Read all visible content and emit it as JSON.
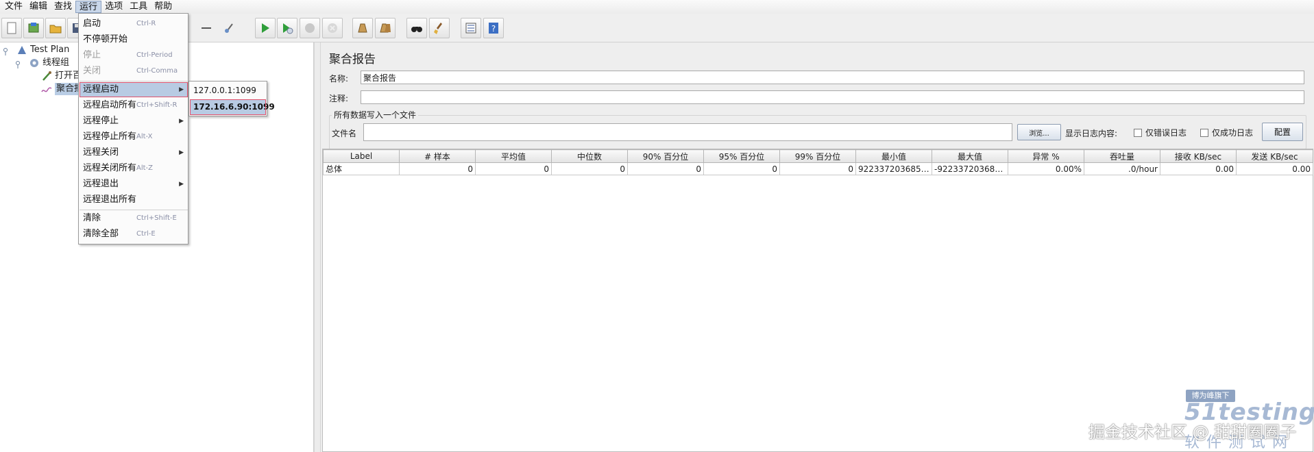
{
  "menubar": [
    "文件",
    "编辑",
    "查找",
    "运行",
    "选项",
    "工具",
    "帮助"
  ],
  "tree": {
    "root": "Test Plan",
    "thread_group": "线程组",
    "child1": "打开百",
    "child2": "聚合报"
  },
  "run_menu": {
    "items": [
      {
        "label": "启动",
        "accel": "Ctrl-R",
        "disabled": false
      },
      {
        "label": "不停顿开始",
        "accel": "",
        "disabled": false
      },
      {
        "label": "停止",
        "accel": "Ctrl-Period",
        "disabled": true
      },
      {
        "label": "关闭",
        "accel": "Ctrl-Comma",
        "disabled": true
      },
      {
        "label": "远程启动",
        "accel": "",
        "submenu": true,
        "highlighted": true
      },
      {
        "label": "远程启动所有",
        "accel": "Ctrl+Shift-R"
      },
      {
        "label": "远程停止",
        "accel": "",
        "submenu": true
      },
      {
        "label": "远程停止所有",
        "accel": "Alt-X"
      },
      {
        "label": "远程关闭",
        "accel": "",
        "submenu": true
      },
      {
        "label": "远程关闭所有",
        "accel": "Alt-Z"
      },
      {
        "label": "远程退出",
        "accel": "",
        "submenu": true
      },
      {
        "label": "远程退出所有",
        "accel": ""
      },
      {
        "label": "清除",
        "accel": "Ctrl+Shift-E"
      },
      {
        "label": "清除全部",
        "accel": "Ctrl-E"
      }
    ],
    "submenu": [
      "127.0.0.1:1099",
      "172.16.6.90:1099"
    ]
  },
  "report": {
    "title": "聚合报告",
    "name_label": "名称:",
    "name_value": "聚合报告",
    "comment_label": "注释:",
    "comment_value": "",
    "file_group_title": "所有数据写入一个文件",
    "file_label": "文件名",
    "browse_button": "浏览...",
    "log_label": "显示日志内容:",
    "errors_only": "仅错误日志",
    "success_only": "仅成功日志",
    "config_button": "配置"
  },
  "table": {
    "headers": [
      "Label",
      "# 样本",
      "平均值",
      "中位数",
      "90% 百分位",
      "95% 百分位",
      "99% 百分位",
      "最小值",
      "最大值",
      "异常 %",
      "吞吐量",
      "接收 KB/sec",
      "发送 KB/sec"
    ],
    "rows": [
      [
        "总体",
        "0",
        "0",
        "0",
        "0",
        "0",
        "0",
        "92233720368547...",
        "-9223372036854...",
        "0.00%",
        ".0/hour",
        "0.00",
        "0.00"
      ]
    ]
  },
  "watermark": {
    "juejin": "掘金技术社区 @ 甜甜圈圈子",
    "badge": "博为峰旗下",
    "brand": "51testing",
    "brand_sub": "软件测试网"
  }
}
